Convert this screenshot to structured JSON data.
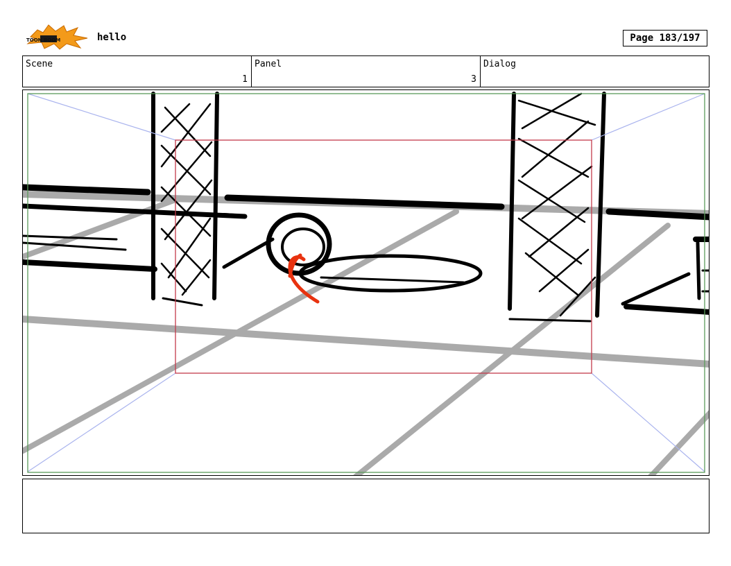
{
  "header": {
    "logo_text": "TOON BOOM",
    "project_title": "hello",
    "page_label": "Page 183/197"
  },
  "info": {
    "scene": {
      "label": "Scene",
      "value": "1"
    },
    "panel": {
      "label": "Panel",
      "value": "3"
    },
    "dialog": {
      "label": "Dialog",
      "value": ""
    }
  },
  "notes": {
    "text": ""
  },
  "colors": {
    "camera_frame_outer": "#5a9a5a",
    "camera_frame_inner": "#c23a4a",
    "camera_guide": "#aab4ee",
    "sketch_red": "#e8320f",
    "floor_grey": "#aaaaaa"
  }
}
